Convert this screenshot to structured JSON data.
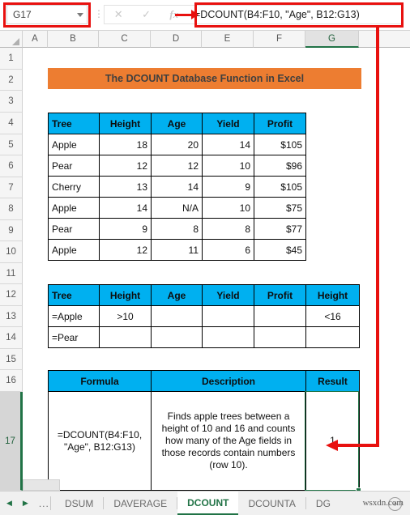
{
  "formula_bar": {
    "name_box_value": "G17",
    "name_box_caret": "chevron-down-icon",
    "separator_dots": "⋮",
    "cancel_icon": "✕",
    "confirm_icon": "✓",
    "fx_icon": "fx",
    "formula_value": "=DCOUNT(B4:F10, \"Age\", B12:G13)"
  },
  "grid": {
    "columns": [
      "A",
      "B",
      "C",
      "D",
      "E",
      "F",
      "G"
    ],
    "selected_column": "G",
    "rows": [
      "1",
      "2",
      "3",
      "4",
      "5",
      "6",
      "7",
      "8",
      "9",
      "10",
      "11",
      "12",
      "13",
      "14",
      "15",
      "16",
      "17"
    ],
    "selected_row": "17",
    "banner_title": "The DCOUNT Database Function in Excel"
  },
  "data_table": {
    "headers": [
      "Tree",
      "Height",
      "Age",
      "Yield",
      "Profit"
    ],
    "rows": [
      [
        "Apple",
        "18",
        "20",
        "14",
        "$105"
      ],
      [
        "Pear",
        "12",
        "12",
        "10",
        "$96"
      ],
      [
        "Cherry",
        "13",
        "14",
        "9",
        "$105"
      ],
      [
        "Apple",
        "14",
        "N/A",
        "10",
        "$75"
      ],
      [
        "Pear",
        "9",
        "8",
        "8",
        "$77"
      ],
      [
        "Apple",
        "12",
        "11",
        "6",
        "$45"
      ]
    ]
  },
  "criteria_table": {
    "headers": [
      "Tree",
      "Height",
      "Age",
      "Yield",
      "Profit",
      "Height"
    ],
    "rows": [
      [
        "=Apple",
        ">10",
        "",
        "",
        "",
        "<16"
      ],
      [
        "=Pear",
        "",
        "",
        "",
        "",
        ""
      ]
    ]
  },
  "formula_table": {
    "headers": [
      "Formula",
      "Description",
      "Result"
    ],
    "row": {
      "formula": "=DCOUNT(B4:F10, \"Age\", B12:G13)",
      "description": "Finds apple trees between a height of 10 and 16 and counts how many of the Age fields in those records contain numbers (row 10).",
      "result": "1"
    }
  },
  "tab_bar": {
    "nav_first_icon": "◀",
    "nav_last_icon": "▶",
    "nav_dots": "...",
    "tabs": [
      {
        "label": "DSUM",
        "active": false
      },
      {
        "label": "DAVERAGE",
        "active": false
      },
      {
        "label": "DCOUNT",
        "active": true
      },
      {
        "label": "DCOUNTA",
        "active": false
      },
      {
        "label": "DG",
        "active": false
      }
    ],
    "add_sheet_icon": "+",
    "watermark": "wsxdn.com"
  },
  "colors": {
    "banner_fill": "#ed7d31",
    "table_header_fill": "#00b0f0",
    "selection_green": "#217346",
    "annotation_red": "#e8110f"
  }
}
